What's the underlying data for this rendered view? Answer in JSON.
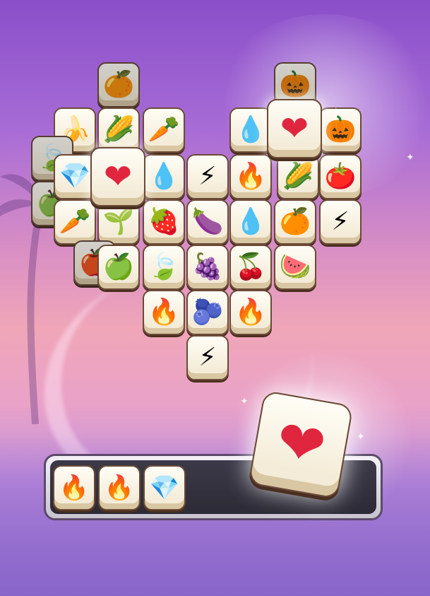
{
  "board": {
    "tiles": [
      {
        "icon": "🍊",
        "name": "orange-icon",
        "layer": "back"
      },
      {
        "icon": "🎃",
        "name": "pumpkin-icon",
        "layer": "back"
      },
      {
        "icon": "🍌",
        "name": "banana-icon",
        "layer": "top"
      },
      {
        "icon": "🌽",
        "name": "corn-icon",
        "layer": "top"
      },
      {
        "icon": "🥕",
        "name": "carrot-icon",
        "layer": "top"
      },
      {
        "icon": "💧",
        "name": "water-drop-icon",
        "layer": "top"
      },
      {
        "icon": "🎃",
        "name": "pumpkin-icon",
        "layer": "top"
      },
      {
        "icon": "🍃",
        "name": "leaf-icon",
        "layer": "back"
      },
      {
        "icon": "🍏",
        "name": "green-apple-icon",
        "layer": "back"
      },
      {
        "icon": "💎",
        "name": "purple-gem-icon",
        "layer": "top"
      },
      {
        "icon": "💧",
        "name": "water-drop-icon",
        "layer": "top"
      },
      {
        "icon": "⚡",
        "name": "lightning-icon",
        "layer": "top"
      },
      {
        "icon": "🔥",
        "name": "fire-icon",
        "layer": "top"
      },
      {
        "icon": "🌽",
        "name": "corn-icon",
        "layer": "top"
      },
      {
        "icon": "🍅",
        "name": "tomato-icon",
        "layer": "top"
      },
      {
        "icon": "🥕",
        "name": "carrot-icon",
        "layer": "top"
      },
      {
        "icon": "🌱",
        "name": "sprout-icon",
        "layer": "top"
      },
      {
        "icon": "🍓",
        "name": "strawberry-icon",
        "layer": "top"
      },
      {
        "icon": "🍆",
        "name": "eggplant-icon",
        "layer": "top"
      },
      {
        "icon": "💧",
        "name": "water-drop-icon",
        "layer": "top"
      },
      {
        "icon": "🍊",
        "name": "orange-icon",
        "layer": "top"
      },
      {
        "icon": "⚡",
        "name": "lightning-icon",
        "layer": "top"
      },
      {
        "icon": "🍎",
        "name": "apple-icon",
        "layer": "back"
      },
      {
        "icon": "🍏",
        "name": "green-apple-icon",
        "layer": "top"
      },
      {
        "icon": "🍃",
        "name": "leaf-icon",
        "layer": "top"
      },
      {
        "icon": "🍇",
        "name": "grapes-icon",
        "layer": "top"
      },
      {
        "icon": "🍒",
        "name": "cherries-icon",
        "layer": "top"
      },
      {
        "icon": "🍉",
        "name": "watermelon-icon",
        "layer": "top"
      },
      {
        "icon": "🔥",
        "name": "fire-icon",
        "layer": "top"
      },
      {
        "icon": "🫐",
        "name": "radish-icon",
        "layer": "top"
      },
      {
        "icon": "🔥",
        "name": "fire-icon",
        "layer": "top"
      },
      {
        "icon": "⚡",
        "name": "lightning-icon",
        "layer": "top"
      }
    ],
    "highlight_left": {
      "icon": "❤",
      "name": "heart-icon"
    },
    "highlight_right": {
      "icon": "❤",
      "name": "heart-icon"
    }
  },
  "flying_tile": {
    "icon": "❤",
    "name": "heart-icon"
  },
  "tray": {
    "slots": [
      {
        "icon": "🔥",
        "name": "fire-icon"
      },
      {
        "icon": "🔥",
        "name": "fire-icon"
      },
      {
        "icon": "💎",
        "name": "purple-gem-icon"
      }
    ],
    "capacity": 7
  }
}
